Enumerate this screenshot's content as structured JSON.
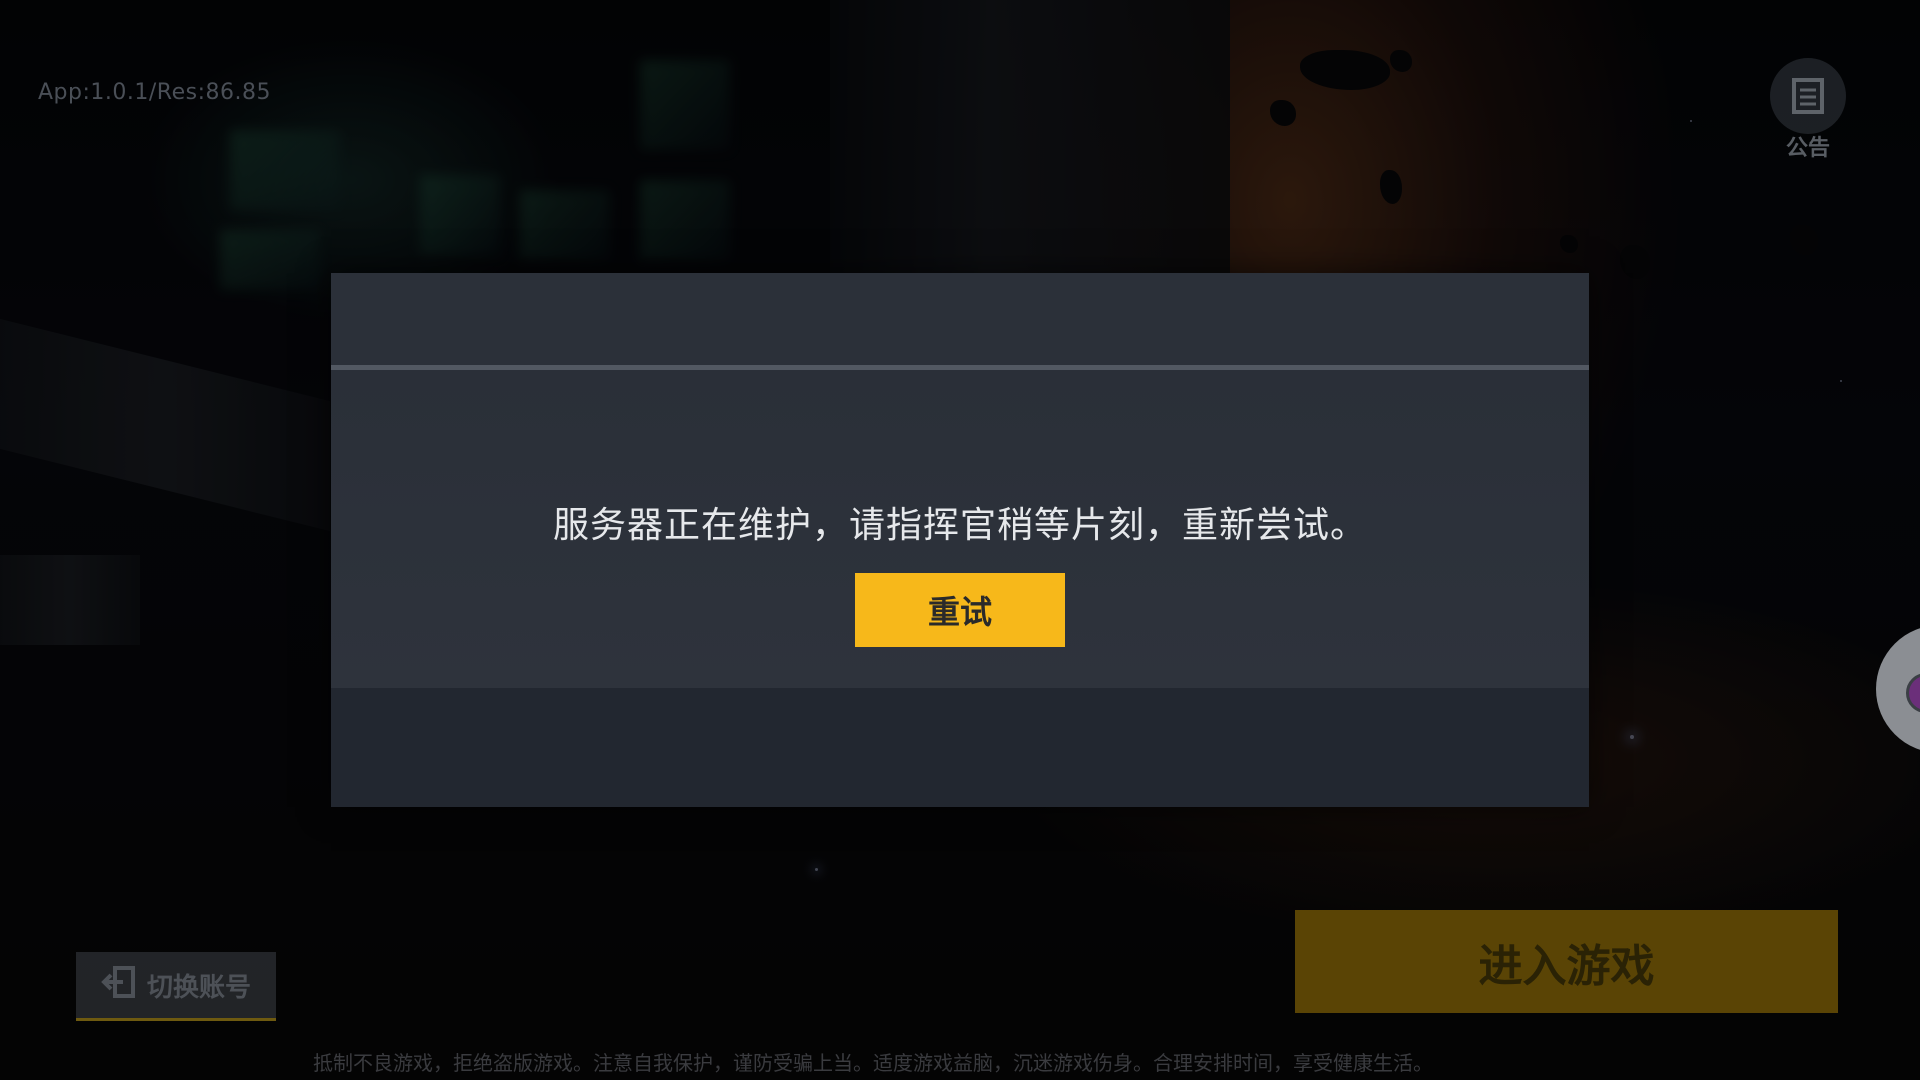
{
  "app": {
    "version_text": "App:1.0.1/Res:86.85"
  },
  "notice": {
    "label": "公告",
    "icon": "notice-icon"
  },
  "dialog": {
    "message": "服务器正在维护，请指挥官稍等片刻，重新尝试。",
    "retry_label": "重试"
  },
  "bottom": {
    "switch_account_label": "切换账号",
    "switch_account_icon": "logout-icon",
    "enter_game_label": "进入游戏",
    "health_notice": "抵制不良游戏，拒绝盗版游戏。注意自我保护，谨防受骗上当。适度游戏益脑，沉迷游戏伤身。合理安排时间，享受健康生活。"
  },
  "colors": {
    "accent": "#f7b81a",
    "dialog_bg": "#2a2f37"
  }
}
